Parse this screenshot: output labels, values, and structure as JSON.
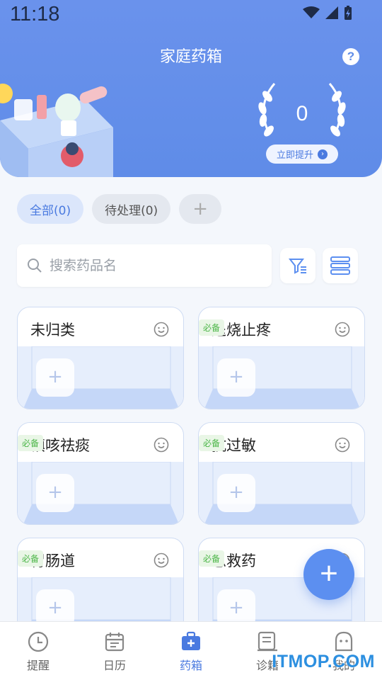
{
  "status_bar": {
    "time": "11:18"
  },
  "header": {
    "title": "家庭药箱",
    "score": "0",
    "upgrade_label": "立即提升"
  },
  "tabs": [
    {
      "label": "全部(0)",
      "active": true
    },
    {
      "label": "待处理(0)",
      "active": false
    },
    {
      "label": "+",
      "active": false
    }
  ],
  "search": {
    "placeholder": "搜索药品名"
  },
  "cards": [
    {
      "title": "未归类",
      "badge": ""
    },
    {
      "title": "退烧止疼",
      "badge": "必备"
    },
    {
      "title": "镇咳祛痰",
      "badge": "必备"
    },
    {
      "title": "抗过敏",
      "badge": "必备"
    },
    {
      "title": "胃肠道",
      "badge": "必备"
    },
    {
      "title": "急救药",
      "badge": "必备"
    }
  ],
  "card_add_symbol": "+",
  "fab_symbol": "+",
  "bottom_nav": [
    {
      "label": "提醒",
      "icon": "clock-icon",
      "active": false
    },
    {
      "label": "日历",
      "icon": "calendar-icon",
      "active": false
    },
    {
      "label": "药箱",
      "icon": "medicine-box-icon",
      "active": true
    },
    {
      "label": "诊籍",
      "icon": "record-icon",
      "active": false
    },
    {
      "label": "我的",
      "icon": "profile-icon",
      "active": false
    }
  ],
  "watermark": "ITMOP.COM",
  "colors": {
    "primary": "#5f8ce8",
    "accent_green": "#4cb648",
    "active_tab": "#4a7ae0"
  }
}
